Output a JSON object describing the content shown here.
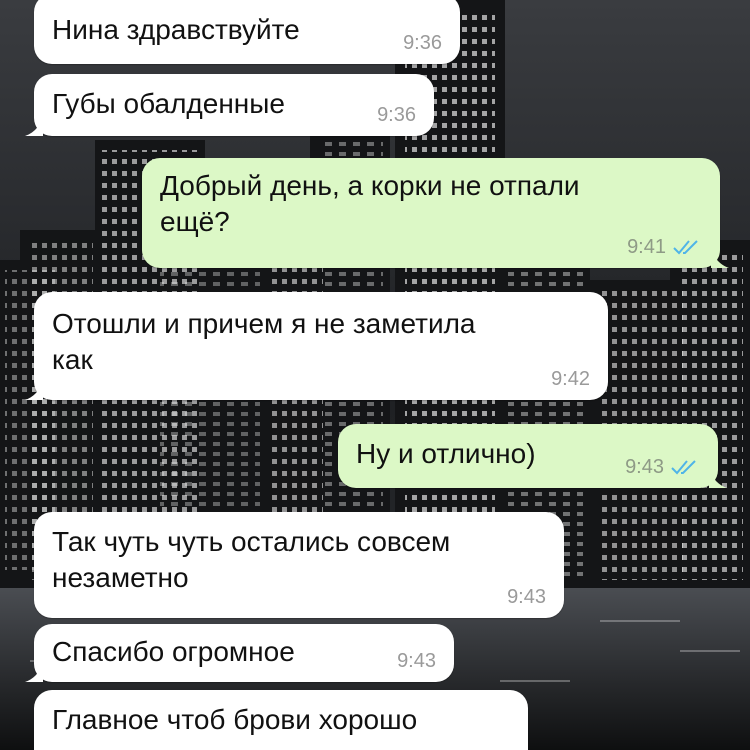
{
  "chat": {
    "messages": [
      {
        "direction": "in",
        "text": "Нина здравствуйте",
        "time": "9:36"
      },
      {
        "direction": "in",
        "text": "Губы обалденные",
        "time": "9:36"
      },
      {
        "direction": "out",
        "text": "Добрый день, а корки не отпали\nещё?",
        "time": "9:41",
        "status_icon": "double-check-read-icon"
      },
      {
        "direction": "in",
        "text": "Отошли и причем я не заметила\nкак",
        "time": "9:42"
      },
      {
        "direction": "out",
        "text": "Ну и отлично)",
        "time": "9:43",
        "status_icon": "double-check-read-icon"
      },
      {
        "direction": "in",
        "text": "Так чуть чуть остались совсем\nнезаметно",
        "time": "9:43"
      },
      {
        "direction": "in",
        "text": "Спасибо огромное",
        "time": "9:43"
      },
      {
        "direction": "in",
        "text": "Главное чтоб брови хорошо",
        "time": ""
      }
    ]
  },
  "colors": {
    "incoming_bubble": "#ffffff",
    "outgoing_bubble": "#dcf8c6",
    "read_ticks": "#4fb4e8"
  }
}
